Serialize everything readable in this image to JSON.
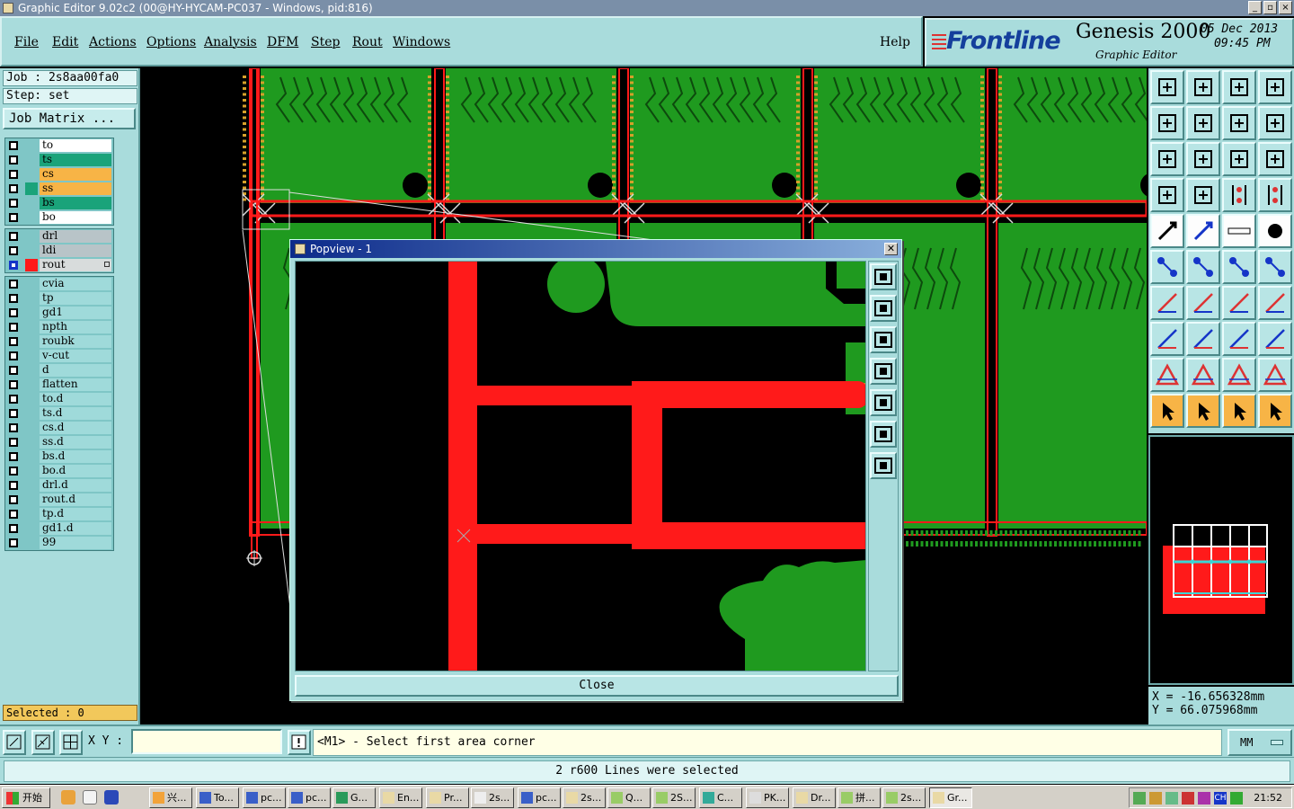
{
  "window": {
    "title": "Graphic Editor 9.02c2 (00@HY-HYCAM-PC037 - Windows, pid:816)",
    "controls": [
      "_",
      "▫",
      "×"
    ]
  },
  "menu": {
    "items": [
      "File",
      "Edit",
      "Actions",
      "Options",
      "Analysis",
      "DFM",
      "Step",
      "Rout",
      "Windows"
    ],
    "help": "Help"
  },
  "brand": {
    "logo": "Frontline",
    "product": "Genesis 2000",
    "subtitle": "Graphic Editor",
    "date": "05 Dec 2013",
    "time": "09:45 PM"
  },
  "job": {
    "job_text": "Job : 2s8aa00fa0",
    "step_text": "Step: set",
    "matrix_button": "Job Matrix ..."
  },
  "layers": {
    "board": [
      {
        "name": "to",
        "color": "#ffffff",
        "swatch": ""
      },
      {
        "name": "ts",
        "color": "#1aa37a",
        "swatch": ""
      },
      {
        "name": "cs",
        "color": "#f7b446",
        "swatch": ""
      },
      {
        "name": "ss",
        "color": "#f7b446",
        "swatch": "#1aa37a"
      },
      {
        "name": "bs",
        "color": "#1aa37a",
        "swatch": ""
      },
      {
        "name": "bo",
        "color": "#ffffff",
        "swatch": ""
      }
    ],
    "drill": [
      {
        "name": "drl",
        "color": "#b8c4c8",
        "swatch": ""
      },
      {
        "name": "ldi",
        "color": "#b8c4c8",
        "swatch": ""
      },
      {
        "name": "rout",
        "color": "#d8dcdc",
        "swatch": "#ff1a1a",
        "active": true
      }
    ],
    "misc": [
      "cvia",
      "tp",
      "gd1",
      "npth",
      "roubk",
      "v-cut",
      "d",
      "flatten",
      "to.d",
      "ts.d",
      "cs.d",
      "ss.d",
      "bs.d",
      "bo.d",
      "drl.d",
      "rout.d",
      "tp.d",
      "gd1.d",
      "99"
    ]
  },
  "selection": {
    "text": "Selected : 0"
  },
  "coords": {
    "x_text": "X = -16.656328mm",
    "y_text": "Y =  66.075968mm"
  },
  "input": {
    "label": "X Y :",
    "value": "",
    "prompt": "<M1> - Select first area corner"
  },
  "units": {
    "selected": "MM"
  },
  "status": {
    "message": "2 r600 Lines were selected"
  },
  "popview": {
    "title": "Popview - 1",
    "close_label": "Close"
  },
  "taskbar": {
    "start": "开始",
    "tasks": [
      "兴...",
      "To...",
      "pc...",
      "pc...",
      "G...",
      "En...",
      "Pr...",
      "2s...",
      "pc...",
      "2s...",
      "Q...",
      "2S...",
      "C...",
      "PK...",
      "Dr...",
      "拼...",
      "2s...",
      "Gr..."
    ],
    "clock": "21:52",
    "tray_label": "CH"
  },
  "colors": {
    "panel": "#a9dcdc",
    "board_green": "#1f9a1f",
    "rout_red": "#ff1a1a",
    "accent_orange": "#f7b446"
  }
}
